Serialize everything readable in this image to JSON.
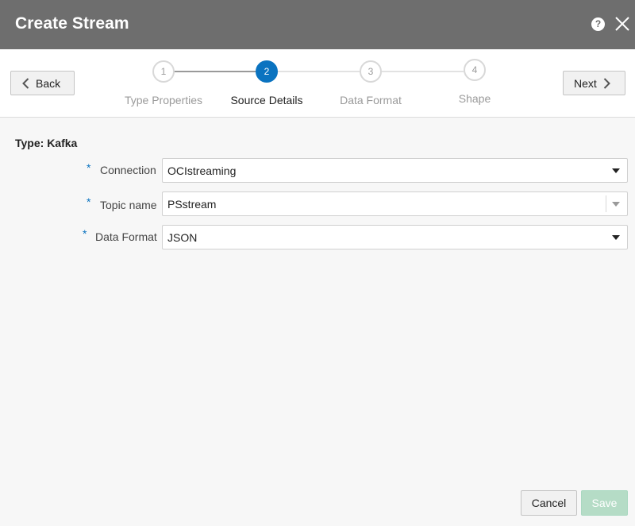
{
  "dialog": {
    "title": "Create Stream",
    "help_label": "?"
  },
  "wizard": {
    "back_label": "Back",
    "next_label": "Next",
    "steps": [
      {
        "number": "1",
        "label": "Type Properties",
        "state": "completed"
      },
      {
        "number": "2",
        "label": "Source Details",
        "state": "active"
      },
      {
        "number": "3",
        "label": "Data Format",
        "state": "pending"
      },
      {
        "number": "4",
        "label": "Shape",
        "state": "pending"
      }
    ],
    "active_color": "#0a73c0"
  },
  "form": {
    "type_label": "Type: Kafka",
    "required_marker": "*",
    "fields": [
      {
        "label": "Connection",
        "value": "OCIstreaming",
        "control": "select"
      },
      {
        "label": "Topic name",
        "value": "PSstream",
        "control": "combobox"
      },
      {
        "label": "Data Format",
        "value": "JSON",
        "control": "select"
      }
    ]
  },
  "footer": {
    "cancel_label": "Cancel",
    "save_label": "Save",
    "save_color": "#b5dcc6"
  }
}
